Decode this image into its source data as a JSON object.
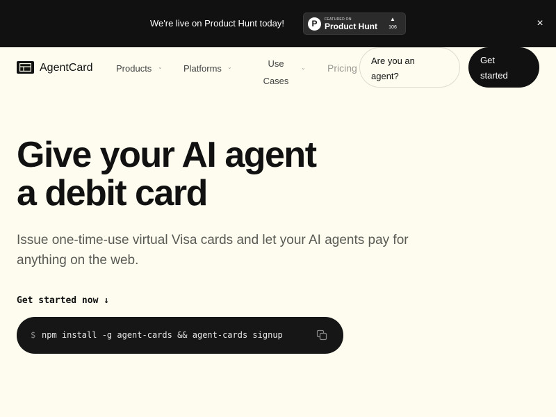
{
  "banner": {
    "text": "We're live on Product Hunt today!",
    "product_hunt": {
      "logo_letter": "P",
      "featured_label": "FEATURED ON",
      "name": "Product Hunt",
      "arrow": "▲",
      "upvotes": "106"
    },
    "close_icon": "×"
  },
  "nav": {
    "logo_text": "AgentCard",
    "items": [
      {
        "label": "Products"
      },
      {
        "label": "Platforms"
      },
      {
        "label_line1": "Use",
        "label_line2": "Cases"
      },
      {
        "label": "Pricing"
      }
    ],
    "chevron": "⌄",
    "agent_button_line1": "Are you an",
    "agent_button_line2": "agent?",
    "cta_line1": "Get",
    "cta_line2": "started"
  },
  "hero": {
    "title_line1": "Give your AI agent",
    "title_line2": "a debit card",
    "subtitle": "Issue one-time-use virtual Visa cards and let your AI agents pay for anything on the web.",
    "cta_label": "Get started now ↓",
    "command_prompt": "$",
    "command": "npm install -g agent-cards && agent-cards signup"
  },
  "colors": {
    "background": "#fdfcee",
    "dark": "#111111",
    "muted_text": "#5a5a55"
  }
}
